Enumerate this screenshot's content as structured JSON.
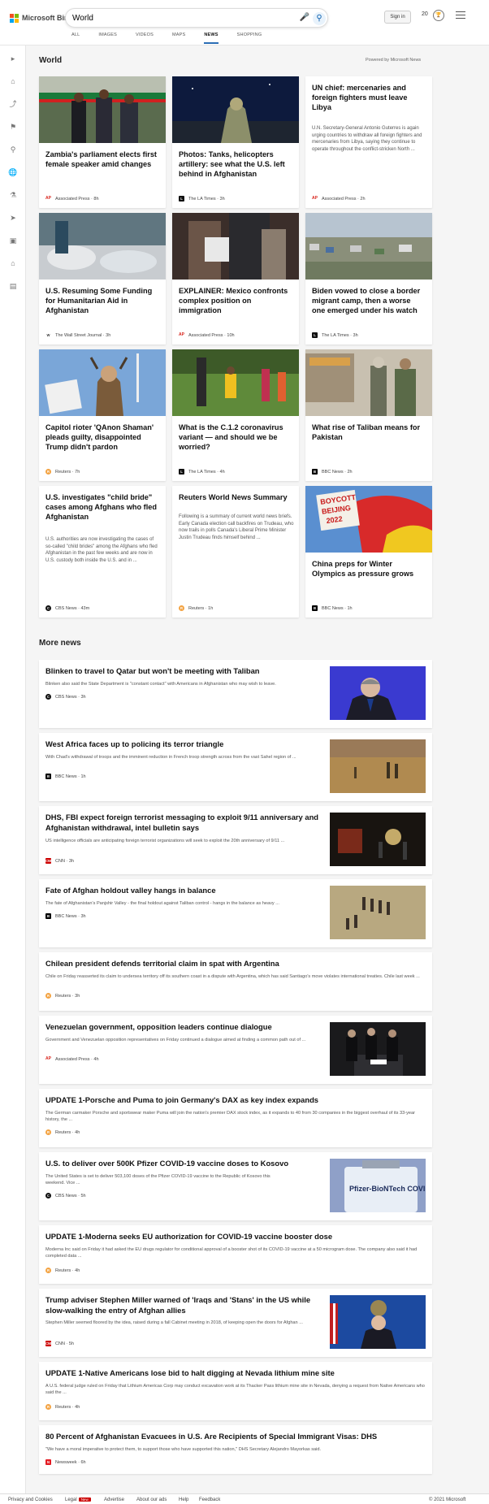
{
  "header": {
    "logo_text": "Microsoft Bing",
    "search_value": "World",
    "sign_in": "Sign in",
    "rewards_count": "20",
    "tabs": [
      "ALL",
      "IMAGES",
      "VIDEOS",
      "MAPS",
      "NEWS",
      "SHOPPING"
    ],
    "active_tab": "NEWS"
  },
  "world": {
    "title": "World",
    "powered_by": "Powered by Microsoft News",
    "cards": [
      {
        "title": "Zambia's parliament elects first female speaker amid changes",
        "source": "Associated Press",
        "time": "8h",
        "logo": "AP"
      },
      {
        "title": "Photos: Tanks, helicopters artillery: see what the U.S. left behind in Afghanistan",
        "source": "The LA Times",
        "time": "3h",
        "logo": "L"
      },
      {
        "title": "UN chief: mercenaries and foreign fighters must leave Libya",
        "snippet": "U.N. Secretary-General Antonio Guterres is again urging countries to withdraw all foreign fighters and mercenaries from Libya, saying they continue to operate throughout the conflict-stricken North ...",
        "source": "Associated Press",
        "time": "2h",
        "logo": "AP"
      },
      {
        "title": "U.S. Resuming Some Funding for Humanitarian Aid in Afghanistan",
        "source": "The Wall Street Journal",
        "time": "3h",
        "logo": "WSJ"
      },
      {
        "title": "EXPLAINER: Mexico confronts complex position on immigration",
        "source": "Associated Press",
        "time": "10h",
        "logo": "AP"
      },
      {
        "title": "Biden vowed to close a border migrant camp, then a worse one emerged under his watch",
        "source": "The LA Times",
        "time": "3h",
        "logo": "L"
      },
      {
        "title": "Capitol rioter 'QAnon Shaman' pleads guilty, disappointed Trump didn't pardon",
        "source": "Reuters",
        "time": "7h",
        "logo": "R"
      },
      {
        "title": "What is the C.1.2 coronavirus variant — and should we be worried?",
        "source": "The LA Times",
        "time": "4h",
        "logo": "L"
      },
      {
        "title": "What rise of Taliban means for Pakistan",
        "source": "BBC News",
        "time": "2h",
        "logo": "BBC"
      },
      {
        "title": "U.S. investigates \"child bride\" cases among Afghans who fled Afghanistan",
        "snippet": "U.S. authorities are now investigating the cases of so-called \"child brides\" among the Afghans who fled Afghanistan in the past few weeks and are now in U.S. custody both inside the U.S. and in ...",
        "source": "CBS News",
        "time": "43m",
        "logo": "CBS"
      },
      {
        "title": "Reuters World News Summary",
        "snippet": "Following is a summary of current world news briefs. Early Canada election call backfires on Trudeau, who now trails in polls Canada's Liberal Prime Minister Justin Trudeau finds himself behind ...",
        "source": "Reuters",
        "time": "1h",
        "logo": "R"
      },
      {
        "title": "China preps for Winter Olympics as pressure grows",
        "source": "BBC News",
        "time": "1h",
        "logo": "BBC",
        "image_sign": [
          "BOYCOTT",
          "BEIJING",
          "2022"
        ]
      }
    ]
  },
  "more_news": {
    "title": "More news",
    "items": [
      {
        "title": "Blinken to travel to Qatar but won't be meeting with Taliban",
        "snippet": "Blinken also said the State Department is \"constant contact\" with Americans in Afghanistan who may wish to leave.",
        "source": "CBS News",
        "time": "3h",
        "logo": "CBS"
      },
      {
        "title": "West Africa faces up to policing its terror triangle",
        "snippet": "With Chad's withdrawal of troops and the imminent reduction in French troop strength across from the vast Sahel region of ...",
        "source": "BBC News",
        "time": "1h",
        "logo": "BBC"
      },
      {
        "title": "DHS, FBI expect foreign terrorist messaging to exploit 9/11 anniversary and Afghanistan withdrawal, intel bulletin says",
        "snippet": "US intelligence officials are anticipating foreign terrorist organizations will seek to exploit the 20th anniversary of 9/11 ...",
        "source": "CNN",
        "time": "3h",
        "logo": "CNN"
      },
      {
        "title": "Fate of Afghan holdout valley hangs in balance",
        "snippet": "The fate of Afghanistan's Panjshir Valley - the final holdout against Taliban control - hangs in the balance as heavy ...",
        "source": "BBC News",
        "time": "3h",
        "logo": "BBC"
      },
      {
        "title": "Chilean president defends territorial claim in spat with Argentina",
        "snippet": "Chile on Friday reasserted its claim to undersea territory off its southern coast in a dispute with Argentina, which has said Santiago's move violates international treaties. Chile last week ...",
        "source": "Reuters",
        "time": "3h",
        "logo": "R"
      },
      {
        "title": "Venezuelan government, opposition leaders continue dialogue",
        "snippet": "Government and Venezuelan opposition representatives on Friday continued a dialogue aimed at finding a common path out of ...",
        "source": "Associated Press",
        "time": "4h",
        "logo": "AP"
      },
      {
        "title": "UPDATE 1-Porsche and Puma to join Germany's DAX as key index expands",
        "snippet": "The German carmaker Porsche and sportswear maker Puma will join the nation's premier DAX stock index, as it expands to 40 from 30 companies in the biggest overhaul of its 33-year history, the ...",
        "source": "Reuters",
        "time": "4h",
        "logo": "R"
      },
      {
        "title": "U.S. to deliver over 500K Pfizer COVID-19 vaccine doses to Kosovo",
        "snippet": "The United States is set to deliver 503,100 doses of the Pfizer COVID-19 vaccine to the Republic of Kosovo this weekend. Vice ...",
        "source": "CBS News",
        "time": "5h",
        "logo": "CBS",
        "image_text": "Pfizer-BioNTech COVID"
      },
      {
        "title": "UPDATE 1-Moderna seeks EU authorization for COVID-19 vaccine booster dose",
        "snippet": "Moderna Inc said on Friday it had asked the EU drugs regulator for conditional approval of a booster shot of its COVID-19 vaccine at a 50 microgram dose. The company also said it had completed data ...",
        "source": "Reuters",
        "time": "4h",
        "logo": "R"
      },
      {
        "title": "Trump adviser Stephen Miller warned of 'Iraqs and 'Stans' in the US while slow-walking the entry of Afghan allies",
        "snippet": "Stephen Miller seemed floored by the idea, raised during a fall Cabinet meeting in 2018, of keeping open the doors for Afghan ...",
        "source": "CNN",
        "time": "5h",
        "logo": "CNN"
      },
      {
        "title": "UPDATE 1-Native Americans lose bid to halt digging at Nevada lithium mine site",
        "snippet": "A U.S. federal judge ruled on Friday that Lithium Americas Corp may conduct excavation work at its Thacker Pass lithium mine site in Nevada, denying a request from Native Americans who said the ...",
        "source": "Reuters",
        "time": "4h",
        "logo": "R"
      },
      {
        "title": "80 Percent of Afghanistan Evacuees in U.S. Are Recipients of Special Immigrant Visas: DHS",
        "snippet": "\"We have a moral imperative to protect them, to support those who have supported this nation,\" DHS Secretary Alejandro Mayorkas said.",
        "source": "Newsweek",
        "time": "6h",
        "logo": "N"
      }
    ]
  },
  "footer": {
    "links": [
      "Privacy and Cookies",
      "Legal",
      "Advertise",
      "About our ads",
      "Help",
      "Feedback"
    ],
    "new_badge": "New",
    "copyright": "© 2021 Microsoft"
  }
}
